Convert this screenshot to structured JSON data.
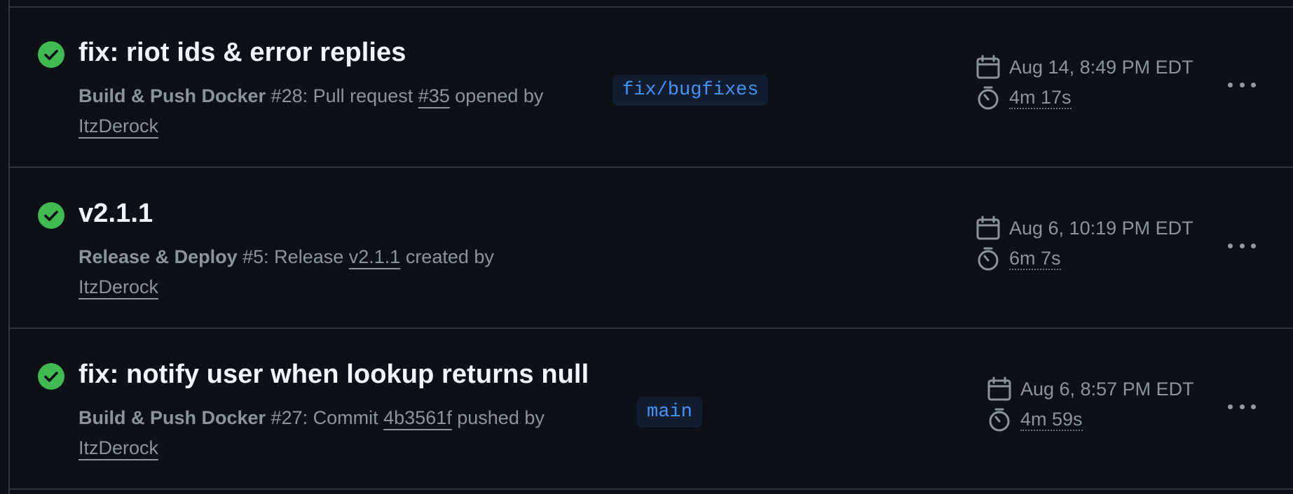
{
  "runs": [
    {
      "title": "fix: riot ids & error replies",
      "workflow": "Build & Push Docker",
      "run_number": "#28",
      "event_prefix": ": Pull request ",
      "ref": "#35",
      "event_suffix": " opened by",
      "actor": "ItzDerock",
      "branch": "fix/bugfixes",
      "date": "Aug 14, 8:49 PM EDT",
      "duration": "4m 17s",
      "status": "success"
    },
    {
      "title": "v2.1.1",
      "workflow": "Release & Deploy",
      "run_number": "#5",
      "event_prefix": ": Release ",
      "ref": "v2.1.1",
      "event_suffix": " created by",
      "actor": "ItzDerock",
      "branch": "",
      "date": "Aug 6, 10:19 PM EDT",
      "duration": "6m 7s",
      "status": "success"
    },
    {
      "title": "fix: notify user when lookup returns null",
      "workflow": "Build & Push Docker",
      "run_number": "#27",
      "event_prefix": ": Commit ",
      "ref": "4b3561f",
      "event_suffix": " pushed by",
      "actor": "ItzDerock",
      "branch": "main",
      "date": "Aug 6, 8:57 PM EDT",
      "duration": "4m 59s",
      "status": "success"
    }
  ],
  "icons": {
    "status": "check-circle-fill-icon",
    "date": "calendar-icon",
    "duration": "stopwatch-icon",
    "menu": "kebab-horizontal-icon"
  },
  "colors": {
    "background": "#0d1117",
    "success": "#3fb950",
    "link": "#4493f8",
    "muted": "#8b949e",
    "border": "#30363d"
  }
}
